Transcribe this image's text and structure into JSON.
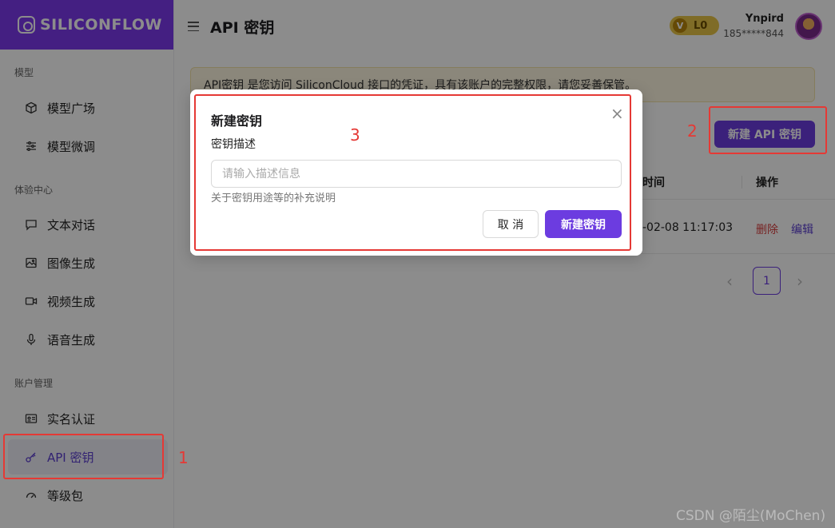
{
  "app": {
    "logo_text": "SILICONFLOW",
    "accent_color": "#7c3aed"
  },
  "sidebar": {
    "sections": [
      {
        "label": "模型"
      },
      {
        "label": "体验中心"
      },
      {
        "label": "账户管理"
      }
    ],
    "items": [
      {
        "label": "模型广场",
        "icon": "cube-icon"
      },
      {
        "label": "模型微调",
        "icon": "sliders-icon"
      },
      {
        "label": "文本对话",
        "icon": "chat-icon"
      },
      {
        "label": "图像生成",
        "icon": "image-icon"
      },
      {
        "label": "视频生成",
        "icon": "video-icon"
      },
      {
        "label": "语音生成",
        "icon": "microphone-icon"
      },
      {
        "label": "实名认证",
        "icon": "id-card-icon"
      },
      {
        "label": "API 密钥",
        "icon": "key-icon",
        "active": true
      },
      {
        "label": "等级包",
        "icon": "gauge-icon"
      }
    ]
  },
  "header": {
    "title": "API 密钥",
    "level_badge_letter": "V",
    "level_badge": "L0",
    "user_name": "Ynpird",
    "user_phone": "185*****844"
  },
  "main": {
    "notice": "API密钥 是您访问 SiliconCloud 接口的凭证，具有该账户的完整权限，请您妥善保管。",
    "new_key_button": "新建 API 密钥",
    "table": {
      "headers": {
        "time": "时间",
        "actions": "操作"
      },
      "rows": [
        {
          "time": "-02-08 11:17:03",
          "delete": "删除",
          "edit": "编辑"
        }
      ]
    },
    "pagination": {
      "prev": "‹",
      "current_page": "1",
      "next": "›"
    }
  },
  "modal": {
    "title": "新建密钥",
    "close": "×",
    "field_label": "密钥描述",
    "input_placeholder": "请输入描述信息",
    "input_value": "",
    "help_text": "关于密钥用途等的补充说明",
    "cancel": "取 消",
    "submit": "新建密钥"
  },
  "annotations": {
    "label_1": "1",
    "label_2": "2",
    "label_3": "3"
  },
  "watermark": "CSDN @陌尘(MoChen)"
}
